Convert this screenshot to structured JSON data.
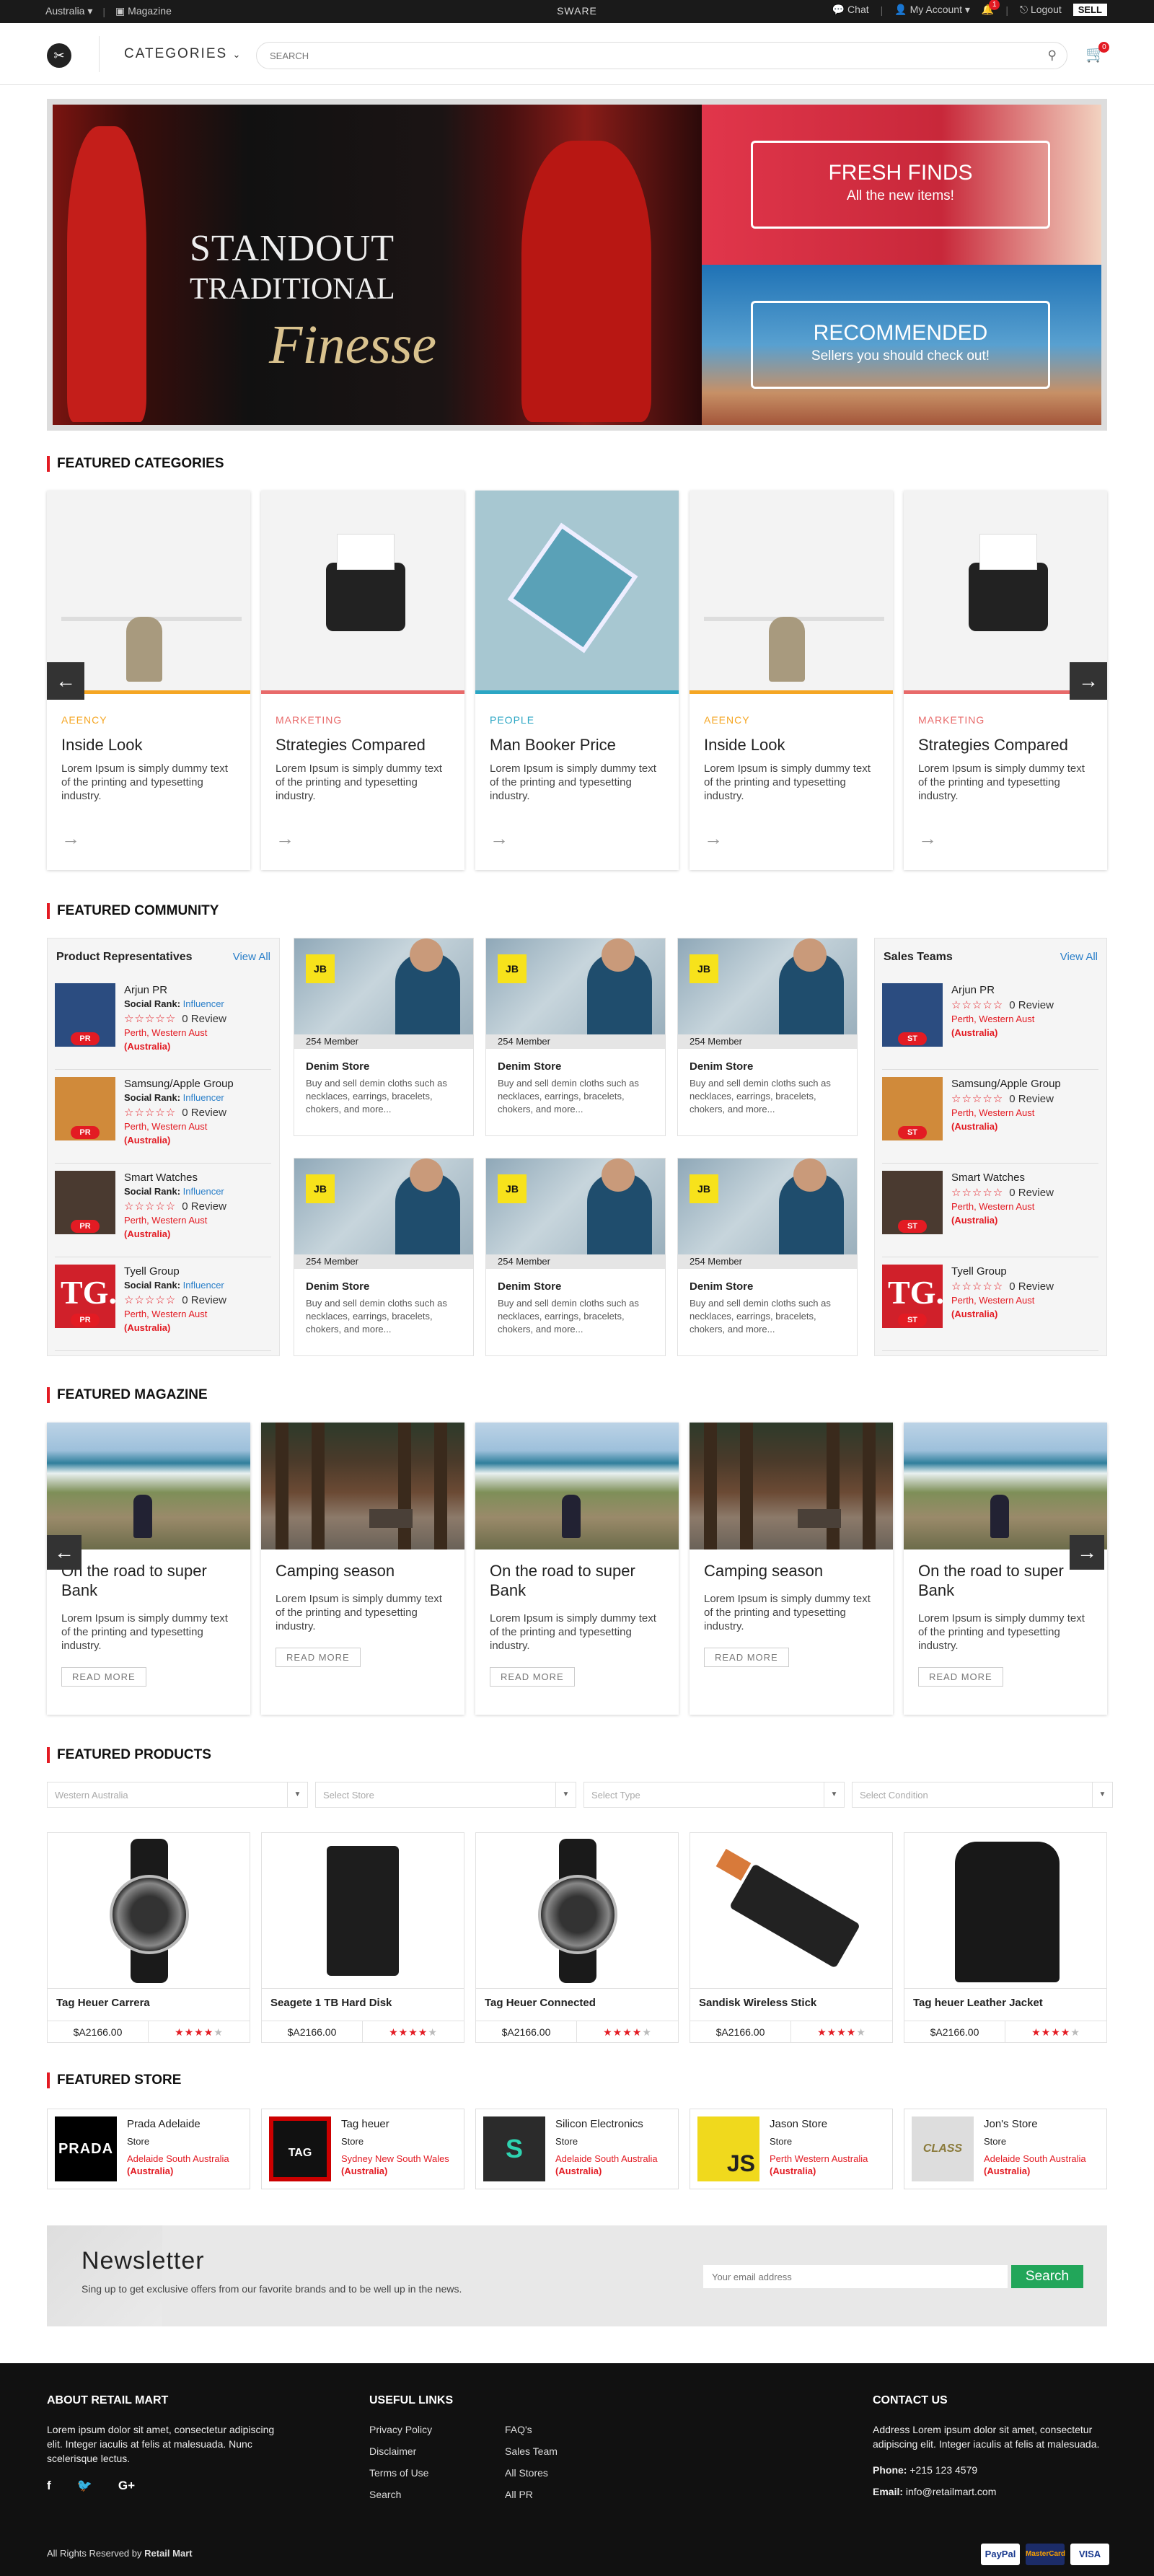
{
  "topbar": {
    "location": "Australia",
    "magazine": "Magazine",
    "brand": "SWARE",
    "chat": "Chat",
    "my_account": "My Account",
    "notif_count": "1",
    "logout": "Logout",
    "sell": "SELL"
  },
  "header": {
    "categories": "CATEGORIES",
    "search_placeholder": "SEARCH",
    "cart_count": "0"
  },
  "hero": {
    "line1": "STANDOUT",
    "line2": "TRADITIONAL",
    "line3": "Finesse",
    "promo1_title": "FRESH FINDS",
    "promo1_sub": "All the new items!",
    "promo2_title": "RECOMMENDED",
    "promo2_sub": "Sellers you should check out!"
  },
  "featured_categories": {
    "title": "FEATURED CATEGORIES",
    "cards": [
      {
        "tag": "AEENCY",
        "title": "Inside Look",
        "desc": "Lorem Ipsum is simply dummy text of the printing and typesetting industry.",
        "color": "#f5a623"
      },
      {
        "tag": "MARKETING",
        "title": "Strategies Compared",
        "desc": "Lorem Ipsum is simply dummy text of the printing and typesetting industry.",
        "color": "#e86a6a"
      },
      {
        "tag": "PEOPLE",
        "title": "Man Booker Price",
        "desc": "Lorem Ipsum is simply dummy text of the printing and typesetting industry.",
        "color": "#2ba6c4"
      },
      {
        "tag": "AEENCY",
        "title": "Inside Look",
        "desc": "Lorem Ipsum is simply dummy text of the printing and typesetting industry.",
        "color": "#f5a623"
      },
      {
        "tag": "MARKETING",
        "title": "Strategies Compared",
        "desc": "Lorem Ipsum is simply dummy text of the printing and typesetting industry.",
        "color": "#e86a6a"
      }
    ]
  },
  "featured_community": {
    "title": "FEATURED COMMUNITY",
    "reps": {
      "heading": "Product Representatives",
      "view_all": "View All",
      "items": [
        {
          "name": "Arjun PR",
          "rank_label": "Social Rank:",
          "rank": "Influencer",
          "review": "0 Review",
          "loc": "Perth, Western Aust",
          "country": "(Australia)",
          "badge": "PR"
        },
        {
          "name": "Samsung/Apple Group",
          "rank_label": "Social Rank:",
          "rank": "Influencer",
          "review": "0 Review",
          "loc": "Perth, Western Aust",
          "country": "(Australia)",
          "badge": "PR"
        },
        {
          "name": "Smart Watches",
          "rank_label": "Social Rank:",
          "rank": "Influencer",
          "review": "0 Review",
          "loc": "Perth, Western Aust",
          "country": "(Australia)",
          "badge": "PR"
        },
        {
          "name": "Tyell Group",
          "rank_label": "Social Rank:",
          "rank": "Influencer",
          "review": "0 Review",
          "loc": "Perth, Western Aust",
          "country": "(Australia)",
          "badge": "PR"
        }
      ]
    },
    "sales": {
      "heading": "Sales Teams",
      "view_all": "View All",
      "items": [
        {
          "name": "Arjun PR",
          "review": "0 Review",
          "loc": "Perth, Western Aust",
          "country": "(Australia)",
          "badge": "ST"
        },
        {
          "name": "Samsung/Apple Group",
          "review": "0 Review",
          "loc": "Perth, Western Aust",
          "country": "(Australia)",
          "badge": "ST"
        },
        {
          "name": "Smart Watches",
          "review": "0 Review",
          "loc": "Perth, Western Aust",
          "country": "(Australia)",
          "badge": "ST"
        },
        {
          "name": "Tyell Group",
          "review": "0 Review",
          "loc": "Perth, Western Aust",
          "country": "(Australia)",
          "badge": "ST"
        }
      ]
    },
    "stores": [
      {
        "members": "254 Member",
        "name": "Denim Store",
        "desc": "Buy and sell demin cloths such as necklaces, earrings, bracelets, chokers, and more...",
        "logo": "JB"
      },
      {
        "members": "254 Member",
        "name": "Denim Store",
        "desc": "Buy and sell demin cloths such as necklaces, earrings, bracelets, chokers, and more...",
        "logo": "JB"
      },
      {
        "members": "254 Member",
        "name": "Denim Store",
        "desc": "Buy and sell demin cloths such as necklaces, earrings, bracelets, chokers, and more...",
        "logo": "JB"
      },
      {
        "members": "254 Member",
        "name": "Denim Store",
        "desc": "Buy and sell demin cloths such as necklaces, earrings, bracelets, chokers, and more...",
        "logo": "JB"
      },
      {
        "members": "254 Member",
        "name": "Denim Store",
        "desc": "Buy and sell demin cloths such as necklaces, earrings, bracelets, chokers, and more...",
        "logo": "JB"
      },
      {
        "members": "254 Member",
        "name": "Denim Store",
        "desc": "Buy and sell demin cloths such as necklaces, earrings, bracelets, chokers, and more...",
        "logo": "JB"
      }
    ]
  },
  "featured_magazine": {
    "title": "FEATURED MAGAZINE",
    "cards": [
      {
        "title": "On the road to super Bank",
        "desc": "Lorem Ipsum is simply dummy text of the printing and typesetting industry.",
        "btn": "READ MORE",
        "scene": "coast"
      },
      {
        "title": "Camping season",
        "desc": "Lorem Ipsum is simply dummy text of the printing and typesetting industry.",
        "btn": "READ MORE",
        "scene": "forest"
      },
      {
        "title": "On the road to super Bank",
        "desc": "Lorem Ipsum is simply dummy text of the printing and typesetting industry.",
        "btn": "READ MORE",
        "scene": "coast"
      },
      {
        "title": "Camping season",
        "desc": "Lorem Ipsum is simply dummy text of the printing and typesetting industry.",
        "btn": "READ MORE",
        "scene": "forest"
      },
      {
        "title": "On the road to super Bank",
        "desc": "Lorem Ipsum is simply dummy text of the printing and typesetting industry.",
        "btn": "READ MORE",
        "scene": "coast"
      }
    ]
  },
  "featured_products": {
    "title": "FEATURED PRODUCTS",
    "filters": [
      "Western Australia",
      "Select Store",
      "Select Type",
      "Select Condition"
    ],
    "items": [
      {
        "name": "Tag Heuer Carrera",
        "price": "$A2166.00",
        "rating": 4,
        "kind": "watch"
      },
      {
        "name": "Seagete 1 TB Hard Disk",
        "price": "$A2166.00",
        "rating": 4,
        "kind": "disk"
      },
      {
        "name": "Tag Heuer Connected",
        "price": "$A2166.00",
        "rating": 4,
        "kind": "watch"
      },
      {
        "name": "Sandisk Wireless Stick",
        "price": "$A2166.00",
        "rating": 4,
        "kind": "stick"
      },
      {
        "name": "Tag heuer Leather Jacket",
        "price": "$A2166.00",
        "rating": 4,
        "kind": "jacket"
      }
    ]
  },
  "featured_store": {
    "title": "FEATURED STORE",
    "items": [
      {
        "name": "Prada Adelaide",
        "type": "Store",
        "loc": "Adelaide South Australia",
        "country": "(Australia)",
        "logo": "PRADA"
      },
      {
        "name": "Tag heuer",
        "type": "Store",
        "loc": "Sydney New South Wales",
        "country": "(Australia)",
        "logo": "TAG"
      },
      {
        "name": "Silicon Electronics",
        "type": "Store",
        "loc": "Adelaide South Australia",
        "country": "(Australia)",
        "logo": "S"
      },
      {
        "name": "Jason Store",
        "type": "Store",
        "loc": "Perth Western Australia",
        "country": "(Australia)",
        "logo": "JS"
      },
      {
        "name": "Jon's Store",
        "type": "Store",
        "loc": "Adelaide South Australia",
        "country": "(Australia)",
        "logo": "CLASS"
      }
    ]
  },
  "newsletter": {
    "title": "Newsletter",
    "text": "Sing up to get exclusive offers from our favorite brands and to be well up in the news.",
    "placeholder": "Your email address",
    "button": "Search"
  },
  "footer": {
    "about_title": "ABOUT RETAIL MART",
    "about_text": "Lorem ipsum dolor sit amet, consectetur adipiscing elit. Integer iaculis at felis at malesuada. Nunc scelerisque lectus.",
    "links_title": "USEFUL LINKS",
    "links_col1": [
      "Privacy Policy",
      "Disclaimer",
      "Terms of Use",
      "Search"
    ],
    "links_col2": [
      "FAQ's",
      "Sales Team",
      "All Stores",
      "All PR"
    ],
    "contact_title": "CONTACT US",
    "contact_address": "Address Lorem ipsum dolor sit amet, consectetur adipiscing elit. Integer iaculis at felis at malesuada.",
    "phone_label": "Phone:",
    "phone": "+215 123 4579",
    "email_label": "Email:",
    "email": "info@retailmart.com",
    "rights_prefix": "All Rights Reserved by",
    "rights_brand": "Retail Mart",
    "payments": [
      "PayPal",
      "MasterCard",
      "VISA"
    ]
  }
}
